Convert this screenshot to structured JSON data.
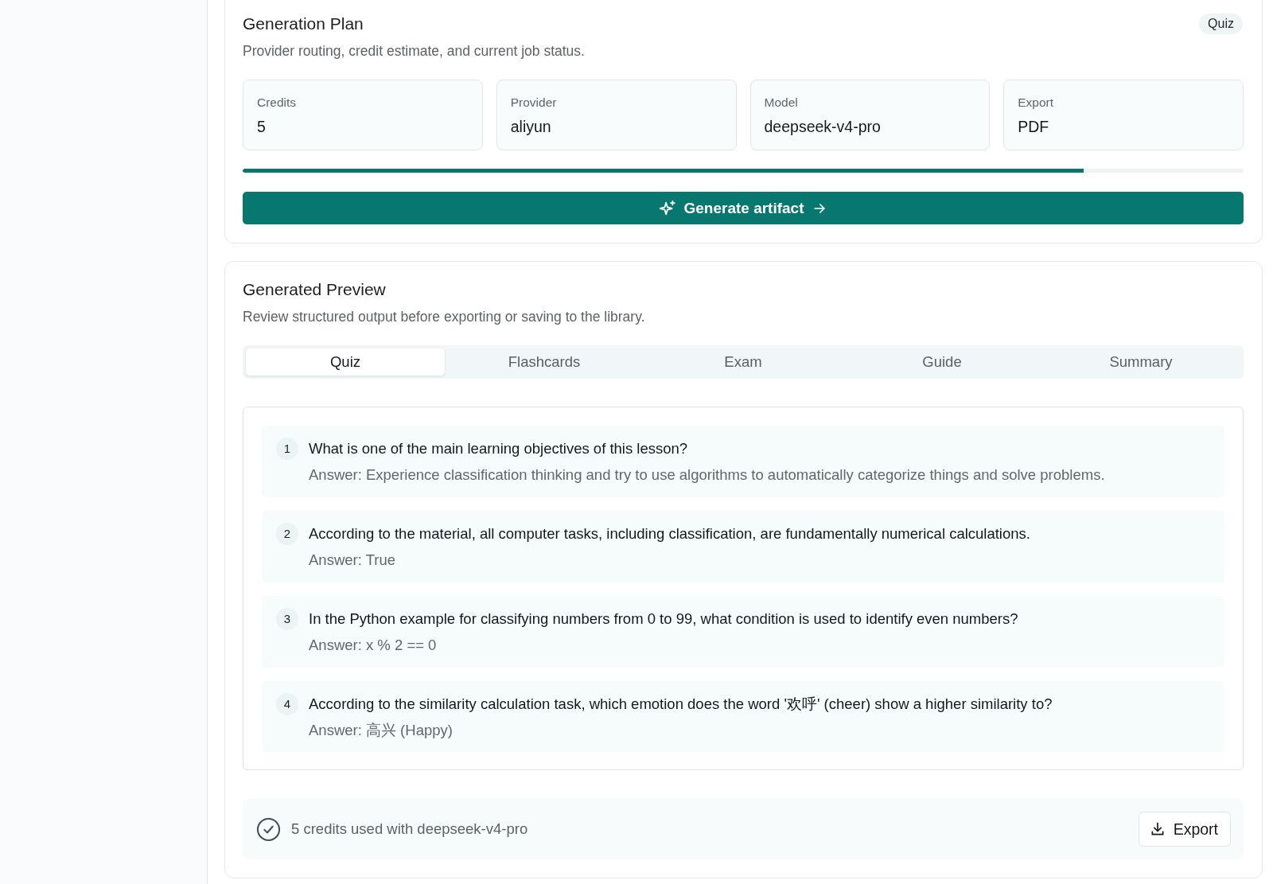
{
  "generation_plan": {
    "title": "Generation Plan",
    "badge": "Quiz",
    "subtitle": "Provider routing, credit estimate, and current job status.",
    "stats": [
      {
        "label": "Credits",
        "value": "5"
      },
      {
        "label": "Provider",
        "value": "aliyun"
      },
      {
        "label": "Model",
        "value": "deepseek-v4-pro"
      },
      {
        "label": "Export",
        "value": "PDF"
      }
    ],
    "progress": {
      "level": 0.84
    },
    "generate_button": {
      "label": "Generate artifact"
    }
  },
  "generated_preview": {
    "title": "Generated Preview",
    "subtitle": "Review structured output before exporting or saving to the library.",
    "tabs": [
      {
        "label": "Quiz",
        "selected": true
      },
      {
        "label": "Flashcards",
        "selected": false
      },
      {
        "label": "Exam",
        "selected": false
      },
      {
        "label": "Guide",
        "selected": false
      },
      {
        "label": "Summary",
        "selected": false
      }
    ],
    "questions": [
      {
        "number": "1",
        "question": "What is one of the main learning objectives of this lesson?",
        "answer": "Answer: Experience classification thinking and try to use algorithms to automatically categorize things and solve problems."
      },
      {
        "number": "2",
        "question": "According to the material, all computer tasks, including classification, are fundamentally numerical calculations.",
        "answer": "Answer: True"
      },
      {
        "number": "3",
        "question": "In the Python example for classifying numbers from 0 to 99, what condition is used to identify even numbers?",
        "answer": "Answer: x % 2 == 0"
      },
      {
        "number": "4",
        "question": "According to the similarity calculation task, which emotion does the word '欢呼' (cheer) show a higher similarity to?",
        "answer": "Answer: 高兴 (Happy)"
      }
    ],
    "footer": {
      "status": "5 credits used with deepseek-v4-pro",
      "export_button": {
        "label": "Export"
      }
    }
  }
}
